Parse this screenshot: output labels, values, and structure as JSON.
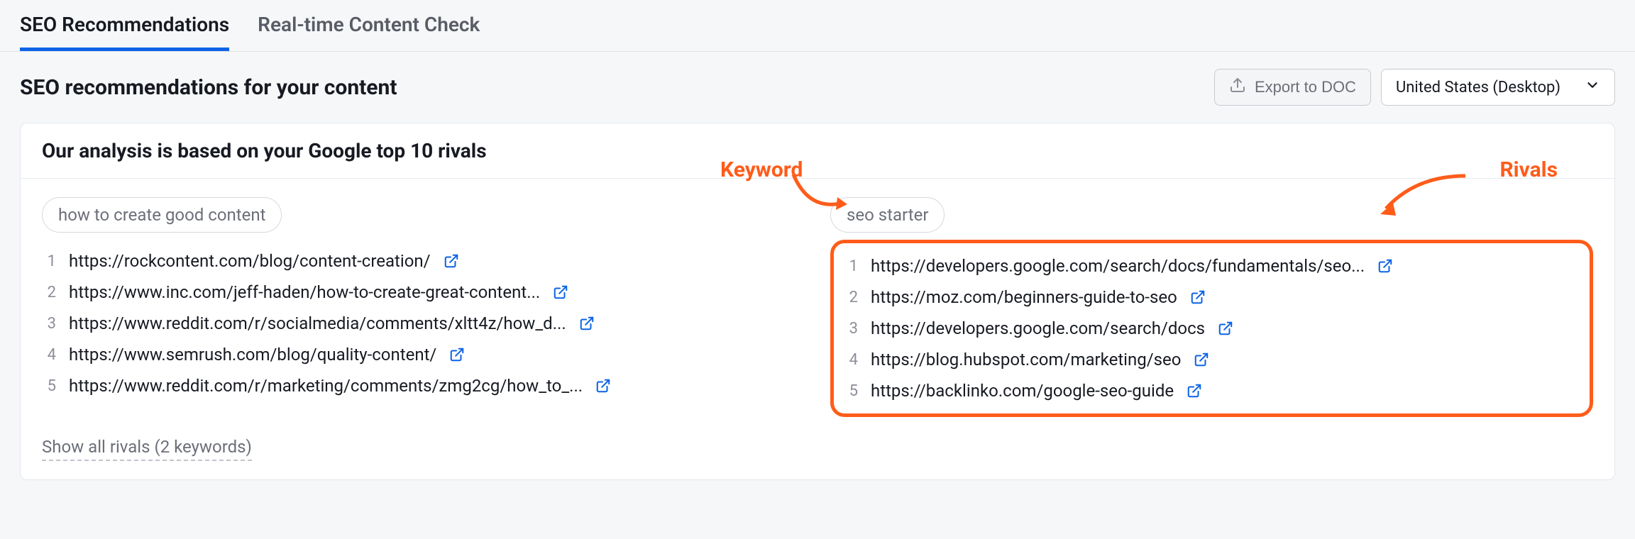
{
  "tabs": {
    "seo": "SEO Recommendations",
    "realtime": "Real-time Content Check"
  },
  "page_title": "SEO recommendations for your content",
  "actions": {
    "export_label": "Export to DOC",
    "region_label": "United States (Desktop)"
  },
  "card": {
    "header": "Our analysis is based on your Google top 10 rivals",
    "keyword_label": "Keyword",
    "rivals_label": "Rivals",
    "show_all": "Show all rivals (2 keywords)",
    "col1": {
      "pill": "how to create good content",
      "items": [
        "https://rockcontent.com/blog/content-creation/",
        "https://www.inc.com/jeff-haden/how-to-create-great-content...",
        "https://www.reddit.com/r/socialmedia/comments/xltt4z/how_d...",
        "https://www.semrush.com/blog/quality-content/",
        "https://www.reddit.com/r/marketing/comments/zmg2cg/how_to_..."
      ]
    },
    "col2": {
      "pill": "seo starter",
      "items": [
        "https://developers.google.com/search/docs/fundamentals/seo...",
        "https://moz.com/beginners-guide-to-seo",
        "https://developers.google.com/search/docs",
        "https://blog.hubspot.com/marketing/seo",
        "https://backlinko.com/google-seo-guide"
      ]
    }
  }
}
